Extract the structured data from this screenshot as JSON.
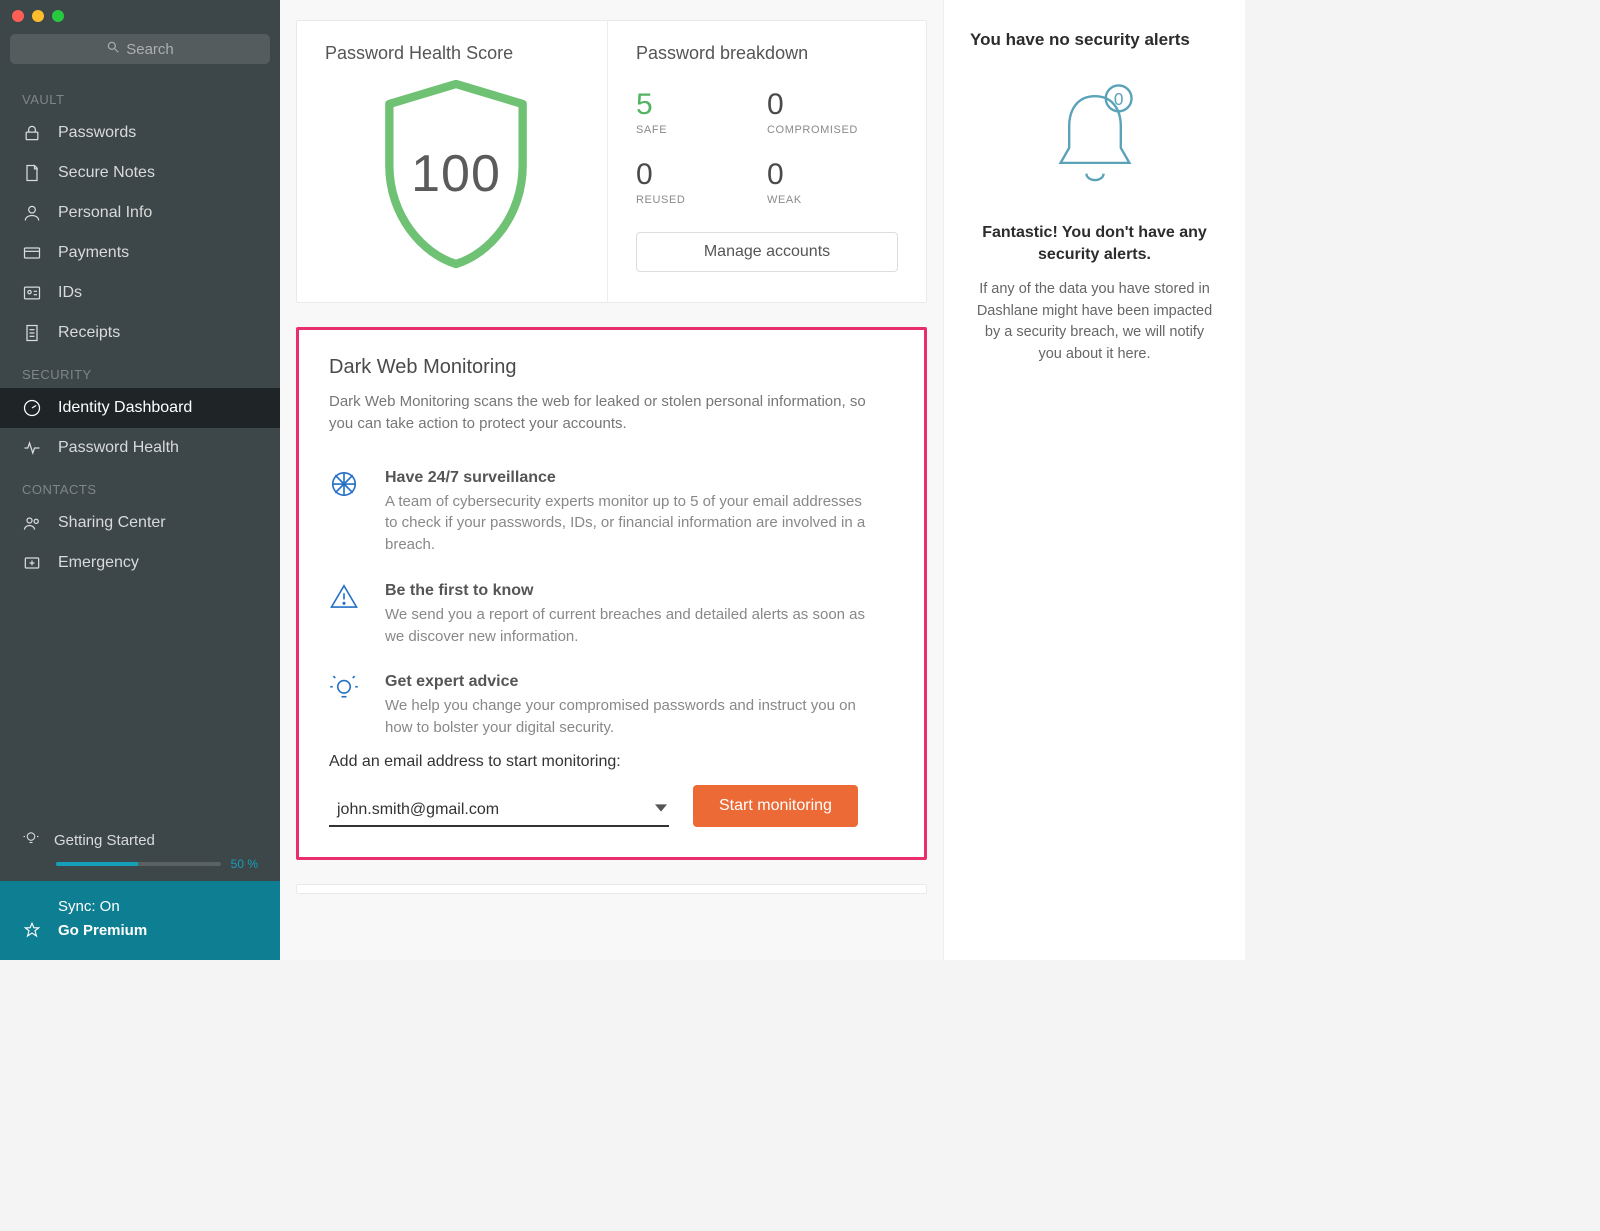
{
  "search": {
    "placeholder": "Search"
  },
  "sidebar": {
    "sections": {
      "vault": "VAULT",
      "security": "SECURITY",
      "contacts": "CONTACTS"
    },
    "items": {
      "passwords": "Passwords",
      "secureNotes": "Secure Notes",
      "personalInfo": "Personal Info",
      "payments": "Payments",
      "ids": "IDs",
      "receipts": "Receipts",
      "identityDashboard": "Identity Dashboard",
      "passwordHealth": "Password Health",
      "sharingCenter": "Sharing Center",
      "emergency": "Emergency"
    },
    "gettingStarted": {
      "label": "Getting Started",
      "pct_label": "50 %",
      "pct_value": 50
    },
    "sync": "Sync: On",
    "premium": "Go Premium"
  },
  "health": {
    "title": "Password Health Score",
    "score": "100",
    "breakdownTitle": "Password breakdown",
    "stats": {
      "safe": {
        "value": "5",
        "label": "SAFE"
      },
      "compromised": {
        "value": "0",
        "label": "COMPROMISED"
      },
      "reused": {
        "value": "0",
        "label": "REUSED"
      },
      "weak": {
        "value": "0",
        "label": "WEAK"
      }
    },
    "manage": "Manage accounts"
  },
  "darkweb": {
    "title": "Dark Web Monitoring",
    "desc": "Dark Web Monitoring scans the web for leaked or stolen personal information, so you can take action to protect your accounts.",
    "features": [
      {
        "title": "Have 24/7 surveillance",
        "body": "A team of cybersecurity experts monitor up to 5 of your email addresses to check if your passwords, IDs, or financial information are involved in a breach."
      },
      {
        "title": "Be the first to know",
        "body": "We send you a report of current breaches and detailed alerts as soon as we discover new information."
      },
      {
        "title": "Get expert advice",
        "body": "We help you change your compromised passwords and instruct you on how to bolster your digital security."
      }
    ],
    "addLabel": "Add an email address to start monitoring:",
    "email": "john.smith@gmail.com",
    "startBtn": "Start monitoring"
  },
  "alerts": {
    "heading": "You have no security alerts",
    "title": "Fantastic! You don't have any security alerts.",
    "body": "If any of the data you have stored in Dashlane might have been impacted by a security breach, we will notify you about it here.",
    "badge": "0"
  }
}
